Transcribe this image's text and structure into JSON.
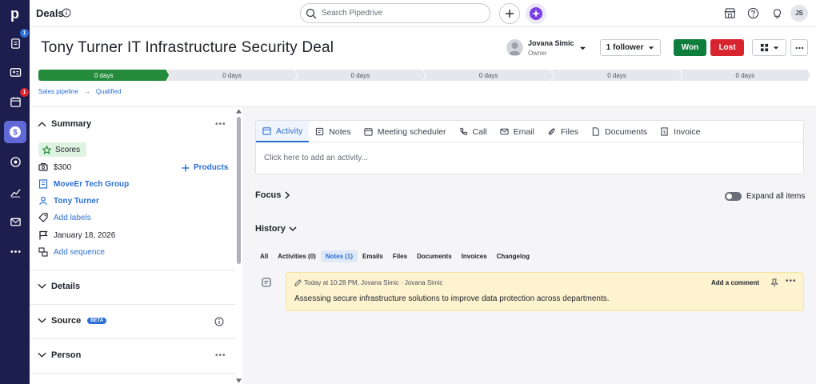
{
  "app": {
    "section_title": "Deals",
    "search_placeholder": "Search Pipedrive",
    "user_initials": "JS"
  },
  "nav": {
    "badges": {
      "leads": "1",
      "activities": "1"
    }
  },
  "deal": {
    "title": "Tony Turner IT Infrastructure Security Deal",
    "owner_name": "Jovana Simic",
    "owner_role": "Owner",
    "follower_label": "1 follower",
    "won_label": "Won",
    "lost_label": "Lost"
  },
  "stages": [
    "0 days",
    "0 days",
    "0 days",
    "0 days",
    "0 days",
    "0 days"
  ],
  "breadcrumb": {
    "pipeline": "Sales pipeline",
    "stage": "Qualified"
  },
  "summary": {
    "heading": "Summary",
    "scores_label": "Scores",
    "value": "$300",
    "products_label": "Products",
    "organization": "MoveEr Tech Group",
    "person": "Tony Turner",
    "add_labels": "Add labels",
    "close_date": "January 18, 2026",
    "add_sequence": "Add sequence"
  },
  "sections": {
    "details": "Details",
    "source": "Source",
    "source_badge": "BETA",
    "person": "Person"
  },
  "tabs": [
    "Activity",
    "Notes",
    "Meeting scheduler",
    "Call",
    "Email",
    "Files",
    "Documents",
    "Invoice"
  ],
  "activity_placeholder": "Click here to add an activity...",
  "focus_label": "Focus",
  "expand_label": "Expand all items",
  "history": {
    "label": "History",
    "tabs": [
      "All",
      "Activities (0)",
      "Notes (1)",
      "Emails",
      "Files",
      "Documents",
      "Invoices",
      "Changelog"
    ]
  },
  "note": {
    "meta": "Today at 10:28 PM, Jovana Simic · Jovana Simic",
    "body": "Assessing secure infrastructure solutions to improve data protection across departments.",
    "add_comment": "Add a comment"
  },
  "colors": {
    "nav_bg": "#1c1e4d",
    "won": "#0f7d3b",
    "lost": "#d8242f",
    "stage_done": "#238b3b",
    "link": "#2b6fd3",
    "note_bg": "#fdf3cf"
  }
}
